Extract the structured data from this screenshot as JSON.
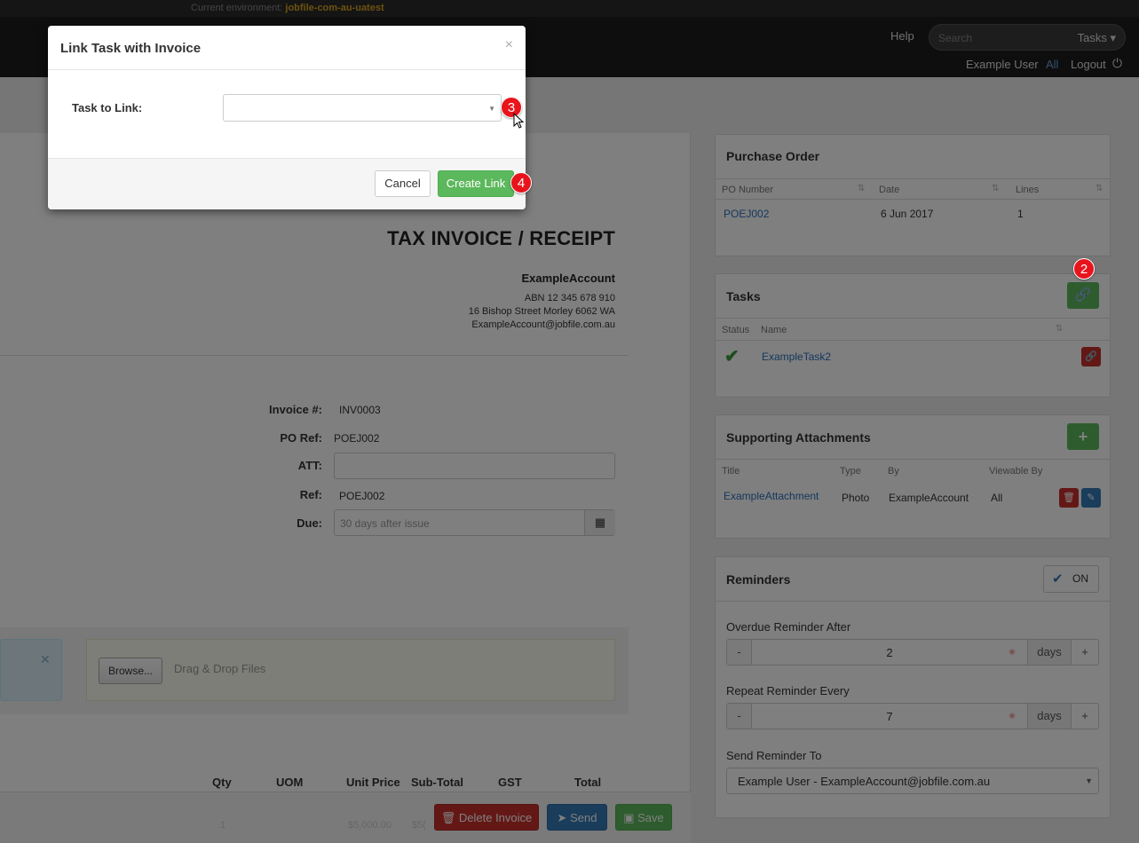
{
  "env": {
    "prefix": "Current environment:",
    "name": "jobfile-com-au-uatest"
  },
  "nav": {
    "help": "Help",
    "search_placeholder": "Search",
    "search_scope": "Tasks ▾",
    "user": "Example User",
    "all": "All",
    "logout": "Logout"
  },
  "invoice": {
    "title": "TAX INVOICE / RECEIPT",
    "account_name": "ExampleAccount",
    "abn": "ABN 12 345 678 910",
    "address": "16 Bishop Street Morley 6062 WA",
    "email": "ExampleAccount@jobfile.com.au",
    "fields": {
      "invoice_label": "Invoice #:",
      "invoice_value": "INV0003",
      "po_label": "PO Ref:",
      "po_value": "POEJ002",
      "att_label": "ATT:",
      "att_value": "",
      "ref_label": "Ref:",
      "ref_value": "POEJ002",
      "due_label": "Due:",
      "due_placeholder": "30 days after issue"
    },
    "upload": {
      "browse": "Browse...",
      "drop_text": "Drag & Drop Files"
    },
    "table_headers": {
      "qty": "Qty",
      "uom": "UOM",
      "unit_price": "Unit Price",
      "subtotal": "Sub-Total",
      "gst": "GST",
      "total": "Total"
    },
    "row_faint": {
      "qty": "1",
      "price": "$5,000.00",
      "sub": "$5("
    },
    "actions": {
      "delete": "Delete Invoice",
      "send": "Send",
      "save": "Save"
    }
  },
  "purchase_order": {
    "title": "Purchase Order",
    "headers": {
      "po_number": "PO Number",
      "date": "Date",
      "lines": "Lines"
    },
    "row": {
      "po_number": "POEJ002",
      "date": "6 Jun 2017",
      "lines": "1"
    }
  },
  "tasks": {
    "title": "Tasks",
    "headers": {
      "status": "Status",
      "name": "Name"
    },
    "row": {
      "name": "ExampleTask2"
    }
  },
  "attachments": {
    "title": "Supporting Attachments",
    "headers": {
      "title": "Title",
      "type": "Type",
      "by": "By",
      "viewable": "Viewable By"
    },
    "row": {
      "title": "ExampleAttachment",
      "type": "Photo",
      "by": "ExampleAccount",
      "viewable": "All"
    }
  },
  "reminders": {
    "title": "Reminders",
    "toggle": "ON",
    "overdue_label": "Overdue Reminder After",
    "overdue_value": "2",
    "repeat_label": "Repeat Reminder Every",
    "repeat_value": "7",
    "unit": "days",
    "minus": "-",
    "plus": "+",
    "send_to_label": "Send Reminder To",
    "send_to_value": "Example User - ExampleAccount@jobfile.com.au"
  },
  "modal": {
    "title": "Link Task with Invoice",
    "close": "×",
    "label": "Task to Link:",
    "cancel": "Cancel",
    "create": "Create Link"
  },
  "badges": {
    "b2": "2",
    "b3": "3",
    "b4": "4"
  },
  "colors": {
    "green": "#5cb85c",
    "red": "#c9302c",
    "blue": "#337ab7",
    "badge": "#e8141c",
    "env": "#d9a41e"
  }
}
